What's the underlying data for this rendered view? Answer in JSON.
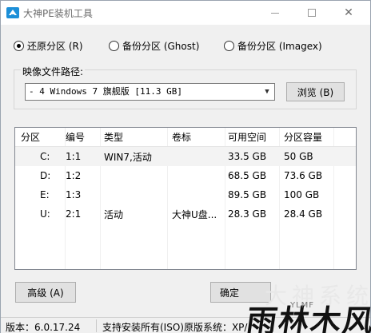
{
  "window": {
    "title": "大神PE装机工具",
    "minimize": "",
    "maximize": "",
    "close": "✕"
  },
  "mode": {
    "options": [
      {
        "label": "还原分区 (R)",
        "checked": true
      },
      {
        "label": "备份分区 (Ghost)",
        "checked": false
      },
      {
        "label": "备份分区 (Imagex)",
        "checked": false
      }
    ]
  },
  "image": {
    "group_label": "映像文件路径:",
    "selected": "- 4 Windows 7 旗舰版 [11.3 GB]",
    "browse_label": "浏览 (B)"
  },
  "table": {
    "columns": [
      "分区",
      "编号",
      "类型",
      "卷标",
      "可用空间",
      "分区容量"
    ],
    "rows": [
      [
        "C:",
        "1:1",
        "WIN7,活动",
        "",
        "33.5 GB",
        "50 GB"
      ],
      [
        "D:",
        "1:2",
        "",
        "",
        "68.5 GB",
        "73.6 GB"
      ],
      [
        "E:",
        "1:3",
        "",
        "",
        "89.5 GB",
        "100 GB"
      ],
      [
        "U:",
        "2:1",
        "活动",
        "大神U盘...",
        "28.3 GB",
        "28.4 GB"
      ]
    ]
  },
  "buttons": {
    "advanced": "高级 (A)",
    "ok": "确定"
  },
  "status": {
    "version": "版本：6.0.17.24",
    "info": "支持安装所有(ISO)原版系统：XP/"
  },
  "watermark": {
    "top": "大神系统",
    "main": "雨林木风",
    "sub": "YLMF"
  }
}
